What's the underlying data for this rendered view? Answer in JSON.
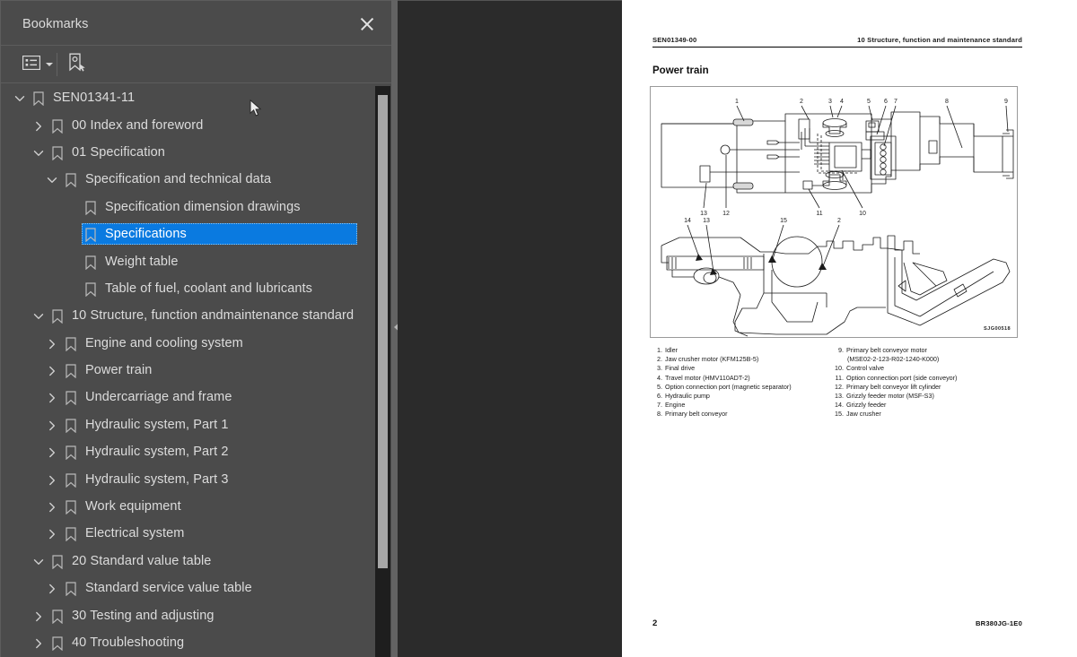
{
  "panel": {
    "title": "Bookmarks",
    "close_icon": "close-icon",
    "toolbar": {
      "options_icon": "list-options-icon",
      "options_caret_icon": "chevron-down-icon",
      "new_bookmark_icon": "new-bookmark-icon"
    }
  },
  "tree": {
    "items": [
      {
        "label": "SEN01341-11",
        "level": 0,
        "twisty": "expanded",
        "selected": false
      },
      {
        "label": "00 Index and foreword",
        "level": 1,
        "twisty": "collapsed",
        "selected": false
      },
      {
        "label": "01 Specification",
        "level": 1,
        "twisty": "expanded",
        "selected": false
      },
      {
        "label": "Specification and technical data",
        "level": 2,
        "twisty": "expanded",
        "selected": false
      },
      {
        "label": "Specification dimension drawings",
        "level": 3,
        "twisty": "none",
        "selected": false
      },
      {
        "label": "Specifications",
        "level": 3,
        "twisty": "none",
        "selected": true
      },
      {
        "label": "Weight table",
        "level": 3,
        "twisty": "none",
        "selected": false
      },
      {
        "label": "Table of fuel, coolant and lubricants",
        "level": 3,
        "twisty": "none",
        "selected": false
      },
      {
        "label": "10 Structure, function andmaintenance standard",
        "level": 1,
        "twisty": "expanded",
        "selected": false
      },
      {
        "label": "Engine and cooling system",
        "level": 2,
        "twisty": "collapsed",
        "selected": false
      },
      {
        "label": "Power train",
        "level": 2,
        "twisty": "collapsed",
        "selected": false
      },
      {
        "label": "Undercarriage and frame",
        "level": 2,
        "twisty": "collapsed",
        "selected": false
      },
      {
        "label": "Hydraulic system, Part 1",
        "level": 2,
        "twisty": "collapsed",
        "selected": false
      },
      {
        "label": "Hydraulic system, Part 2",
        "level": 2,
        "twisty": "collapsed",
        "selected": false
      },
      {
        "label": "Hydraulic system, Part 3",
        "level": 2,
        "twisty": "collapsed",
        "selected": false
      },
      {
        "label": "Work equipment",
        "level": 2,
        "twisty": "collapsed",
        "selected": false
      },
      {
        "label": "Electrical system",
        "level": 2,
        "twisty": "collapsed",
        "selected": false
      },
      {
        "label": "20 Standard value table",
        "level": 1,
        "twisty": "expanded",
        "selected": false
      },
      {
        "label": "Standard service value table",
        "level": 2,
        "twisty": "collapsed",
        "selected": false
      },
      {
        "label": "30 Testing and adjusting",
        "level": 1,
        "twisty": "collapsed",
        "selected": false
      },
      {
        "label": "40 Troubleshooting",
        "level": 1,
        "twisty": "collapsed",
        "selected": false
      }
    ]
  },
  "splitter": {
    "collapse_icon": "collapse-left-arrow-icon"
  },
  "page": {
    "header_left": "SEN01349-00",
    "header_right": "10 Structure, function and maintenance standard",
    "heading": "Power train",
    "figure_code": "SJG00518",
    "legend_left": [
      {
        "num": "1.",
        "text": "Idler"
      },
      {
        "num": "2.",
        "text": "Jaw crusher motor (KFM125B-5)"
      },
      {
        "num": "3.",
        "text": "Final drive"
      },
      {
        "num": "4.",
        "text": "Travel motor (HMV110ADT-2)"
      },
      {
        "num": "5.",
        "text": "Option connection port (magnetic separator)"
      },
      {
        "num": "6.",
        "text": "Hydraulic pump"
      },
      {
        "num": "7.",
        "text": "Engine"
      },
      {
        "num": "8.",
        "text": "Primary belt conveyor"
      }
    ],
    "legend_right": [
      {
        "num": "9.",
        "text": "Primary belt conveyor motor",
        "cont": "(MSE02-2-123-R02-1240-K000)"
      },
      {
        "num": "10.",
        "text": "Control valve",
        "cont": ""
      },
      {
        "num": "11.",
        "text": "Option connection port (side conveyor)",
        "cont": ""
      },
      {
        "num": "12.",
        "text": "Primary belt conveyor lift cylinder",
        "cont": ""
      },
      {
        "num": "13.",
        "text": "Grizzly feeder motor (MSF-S3)",
        "cont": ""
      },
      {
        "num": "14.",
        "text": "Grizzly feeder",
        "cont": ""
      },
      {
        "num": "15.",
        "text": "Jaw crusher",
        "cont": ""
      }
    ],
    "footer_page": "2",
    "footer_doc": "BR380JG-1E0"
  },
  "colors": {
    "panel_bg": "#4b4b4b",
    "viewer_bg": "#2b2b2b",
    "selection": "#0a7ae0",
    "text": "#dcdcdc",
    "page_bg": "#ffffff"
  }
}
